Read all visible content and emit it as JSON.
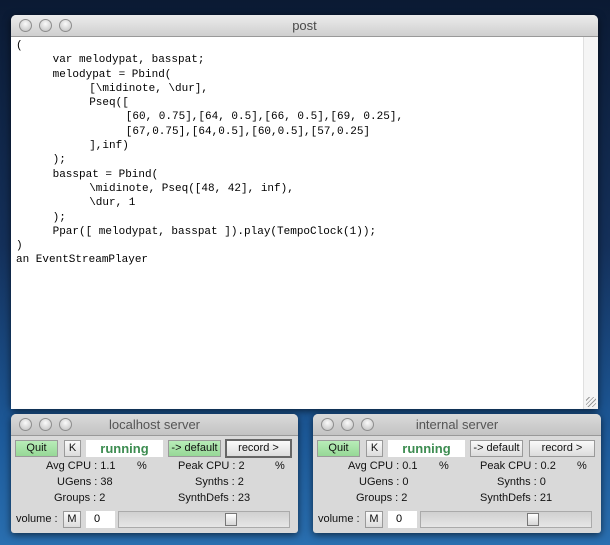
{
  "post": {
    "title": "post",
    "lines": [
      "(",
      "\tvar melodypat, basspat;",
      "\tmelodypat = Pbind(",
      "\t\t[\\midinote, \\dur],",
      "\t\tPseq([",
      "\t\t\t[60, 0.75],[64, 0.5],[66, 0.5],[69, 0.25],",
      "\t\t\t[67,0.75],[64,0.5],[60,0.5],[57,0.25]",
      "\t\t],inf)",
      "\t);",
      "\tbasspat = Pbind(",
      "\t\t\\midinote, Pseq([48, 42], inf),",
      "\t\t\\dur, 1",
      "\t);",
      "\tPpar([ melodypat, basspat ]).play(TempoClock(1));",
      ")",
      "an EventStreamPlayer"
    ]
  },
  "servers": [
    {
      "title": "localhost server",
      "quit": "Quit",
      "kill": "K",
      "status": "running",
      "default": "-> default",
      "record": "record >",
      "avg_cpu": "Avg CPU : 1.1",
      "avg_pct": "%",
      "peak_cpu": "Peak CPU : 2",
      "peak_pct": "%",
      "ugens": "UGens : 38",
      "synths": "Synths : 2",
      "groups": "Groups : 2",
      "synthdefs": "SynthDefs : 23",
      "volume_label": "volume :",
      "mute": "M",
      "volume_value": "0",
      "volume_slider": 0.66
    },
    {
      "title": "internal server",
      "quit": "Quit",
      "kill": "K",
      "status": "running",
      "default": "-> default",
      "record": "record >",
      "avg_cpu": "Avg CPU : 0.1",
      "avg_pct": "%",
      "peak_cpu": "Peak CPU : 0.2",
      "peak_pct": "%",
      "ugens": "UGens : 0",
      "synths": "Synths : 0",
      "groups": "Groups : 2",
      "synthdefs": "SynthDefs : 21",
      "volume_label": "volume :",
      "mute": "M",
      "volume_value": "0",
      "volume_slider": 0.66
    }
  ]
}
